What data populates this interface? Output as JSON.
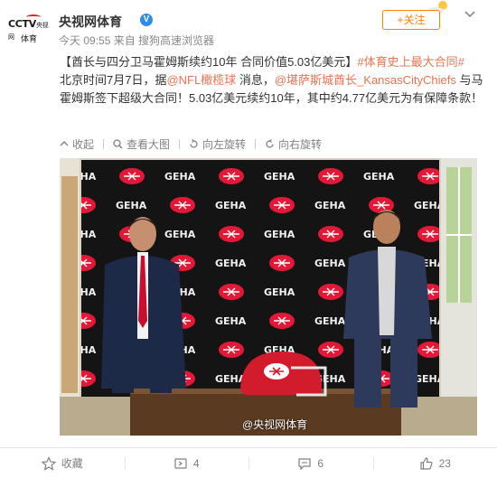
{
  "header": {
    "avatar_logo": "CCTV",
    "avatar_logo_small": "央视网",
    "avatar_sub": "体育",
    "name": "央视网体育",
    "verify_mark": "V",
    "meta": "今天 09:55 来自 搜狗高速浏览器",
    "follow_label": "+关注"
  },
  "post": {
    "headline": "【酋长与四分卫马霍姆斯续约10年 合同价值5.03亿美元】",
    "hashtag": "#体育史上最大合同#",
    "line2_prefix": "北京时间7月7日，据",
    "mention1": "@NFL橄榄球",
    "line2_mid": " 消息，",
    "mention2": "@堪萨斯城酋长_KansasCityChiefs",
    "line2_suffix": " 与马霍姆斯签下超级大合同！5.03亿美元续约10年，其中约4.77亿美元为有保障条款！"
  },
  "toolbar": {
    "collapse": "收起",
    "view_large": "查看大图",
    "rotate_left": "向左旋转",
    "rotate_right": "向右旋转"
  },
  "photo": {
    "backdrop_brand": "GEHA",
    "watermark": "@央视网体育"
  },
  "footer": {
    "favorite": "收藏",
    "repost_count": "4",
    "comment_count": "6",
    "like_count": "23"
  },
  "colors": {
    "accent": "#ff8200",
    "link": "#eb7350",
    "chiefs_red": "#e31837"
  }
}
